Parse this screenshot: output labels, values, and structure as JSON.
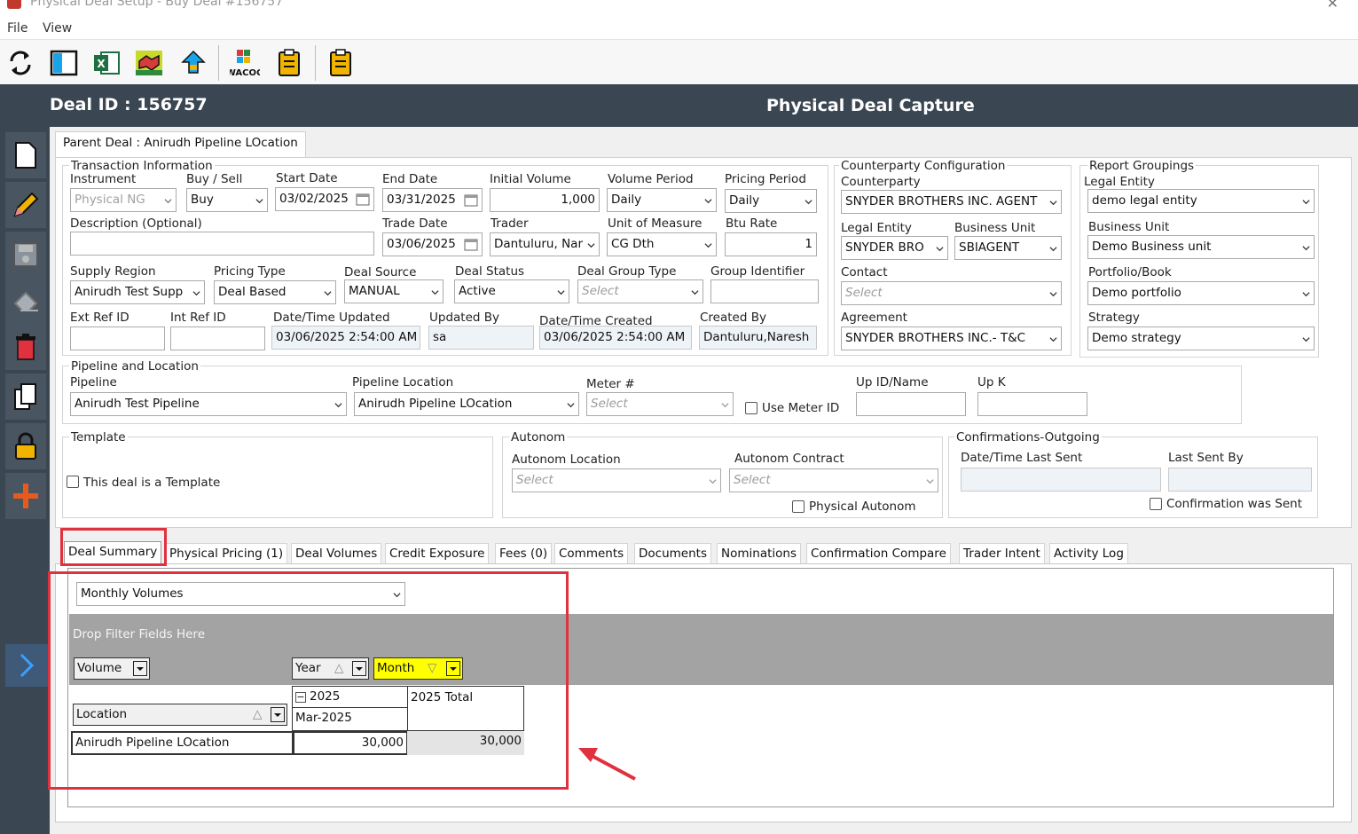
{
  "window": {
    "title": "Physical Deal Setup - Buy Deal #156757"
  },
  "menu": {
    "file": "File",
    "view": "View"
  },
  "toolbar": {
    "icons": [
      "refresh-icon",
      "layout-icon",
      "excel-icon",
      "handshake-icon",
      "upload-icon",
      "wacog-icon",
      "clipboard-icon",
      "clipboard-icon"
    ],
    "wacog": "WACOG"
  },
  "header": {
    "deal_id": "Deal ID : 156757",
    "caption": "Physical Deal Capture"
  },
  "parent_tab": "Parent Deal : Anirudh Pipeline LOcation",
  "transaction": {
    "title": "Transaction Information",
    "instrument": {
      "label": "Instrument",
      "value": "Physical NG"
    },
    "buy_sell": {
      "label": "Buy / Sell",
      "value": "Buy"
    },
    "start_date": {
      "label": "Start Date",
      "value": "03/02/2025"
    },
    "end_date": {
      "label": "End Date",
      "value": "03/31/2025"
    },
    "initial_volume": {
      "label": "Initial Volume",
      "value": "1,000"
    },
    "volume_period": {
      "label": "Volume Period",
      "value": "Daily"
    },
    "pricing_period": {
      "label": "Pricing Period",
      "value": "Daily"
    },
    "description": {
      "label": "Description (Optional)",
      "value": ""
    },
    "trade_date": {
      "label": "Trade Date",
      "value": "03/06/2025"
    },
    "trader": {
      "label": "Trader",
      "value": "Dantuluru, Nar"
    },
    "uom": {
      "label": "Unit of Measure",
      "value": "CG Dth"
    },
    "btu_rate": {
      "label": "Btu Rate",
      "value": "1"
    },
    "supply_region": {
      "label": "Supply Region",
      "value": "Anirudh Test Supp"
    },
    "pricing_type": {
      "label": "Pricing Type",
      "value": "Deal Based"
    },
    "deal_source": {
      "label": "Deal Source",
      "value": "MANUAL"
    },
    "deal_status": {
      "label": "Deal Status",
      "value": "Active"
    },
    "deal_group_type": {
      "label": "Deal Group Type",
      "value": "Select"
    },
    "group_identifier": {
      "label": "Group Identifier",
      "value": ""
    },
    "ext_ref": {
      "label": "Ext Ref ID",
      "value": ""
    },
    "int_ref": {
      "label": "Int Ref ID",
      "value": ""
    },
    "dt_updated": {
      "label": "Date/Time Updated",
      "value": "03/06/2025 2:54:00 AM"
    },
    "updated_by": {
      "label": "Updated By",
      "value": "sa"
    },
    "dt_created": {
      "label": "Date/Time Created",
      "value": "03/06/2025 2:54:00 AM"
    },
    "created_by": {
      "label": "Created By",
      "value": "Dantuluru,Naresh"
    }
  },
  "counterparty": {
    "title": "Counterparty Configuration",
    "counterparty": {
      "label": "Counterparty",
      "value": "SNYDER BROTHERS INC. AGENT"
    },
    "legal_entity": {
      "label": "Legal Entity",
      "value": "SNYDER BRO"
    },
    "business_unit": {
      "label": "Business Unit",
      "value": "SBIAGENT"
    },
    "contact": {
      "label": "Contact",
      "value": "Select"
    },
    "agreement": {
      "label": "Agreement",
      "value": "SNYDER BROTHERS INC.- T&C"
    }
  },
  "report": {
    "title": "Report Groupings",
    "legal_entity": {
      "label": "Legal Entity",
      "value": "demo legal entity"
    },
    "business_unit": {
      "label": "Business Unit",
      "value": "Demo Business unit"
    },
    "portfolio": {
      "label": "Portfolio/Book",
      "value": "Demo portfolio"
    },
    "strategy": {
      "label": "Strategy",
      "value": "Demo strategy"
    }
  },
  "pipeline": {
    "title": "Pipeline and Location",
    "pipeline": {
      "label": "Pipeline",
      "value": "Anirudh Test Pipeline"
    },
    "location": {
      "label": "Pipeline Location",
      "value": "Anirudh Pipeline LOcation"
    },
    "meter": {
      "label": "Meter #",
      "value": "Select"
    },
    "use_meter": "Use Meter ID",
    "up_id": {
      "label": "Up ID/Name",
      "value": ""
    },
    "up_k": {
      "label": "Up K",
      "value": ""
    }
  },
  "template": {
    "title": "Template",
    "checkbox": "This deal is a Template"
  },
  "autonom": {
    "title": "Autonom",
    "location": {
      "label": "Autonom Location",
      "value": "Select"
    },
    "contract": {
      "label": "Autonom Contract",
      "value": "Select"
    },
    "physical": "Physical Autonom"
  },
  "confirmations": {
    "title": "Confirmations-Outgoing",
    "last_sent": {
      "label": "Date/Time Last Sent",
      "value": ""
    },
    "last_sent_by": {
      "label": "Last Sent By",
      "value": ""
    },
    "was_sent": "Confirmation was Sent"
  },
  "tabs": [
    "Deal Summary",
    "Physical Pricing (1)",
    "Deal Volumes",
    "Credit Exposure",
    "Fees (0)",
    "Comments",
    "Documents",
    "Nominations",
    "Confirmation Compare",
    "Trader Intent",
    "Activity Log"
  ],
  "summary": {
    "view_select": "Monthly Volumes",
    "drop_filter": "Drop Filter Fields Here",
    "data_field": "Volume",
    "col_year": "Year",
    "col_month": "Month",
    "row_field": "Location",
    "year_value": "2025",
    "year_total": "2025 Total",
    "month_value": "Mar-2025",
    "row_label": "Anirudh Pipeline LOcation",
    "row_value": "30,000",
    "row_total": "30,000"
  }
}
